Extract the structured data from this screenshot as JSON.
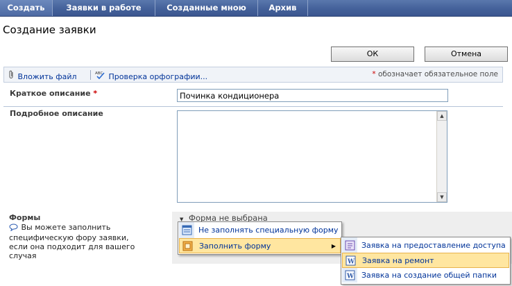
{
  "nav": {
    "tabs": [
      {
        "label": "Создать"
      },
      {
        "label": "Заявки в работе"
      },
      {
        "label": "Созданные мною"
      },
      {
        "label": "Архив"
      }
    ]
  },
  "page": {
    "title": "Создание заявки"
  },
  "actions": {
    "ok_label": "ОК",
    "cancel_label": "Отмена"
  },
  "toolbar": {
    "attach_label": "Вложить файл",
    "spell_label": "Проверка орфографии...",
    "required_star": "*",
    "required_note": "обозначает обязательное поле"
  },
  "fields": {
    "short_desc": {
      "label": "Краткое описание",
      "required_star": "*",
      "value": "Починка кондиционера"
    },
    "long_desc": {
      "label": "Подробное описание",
      "value": ""
    }
  },
  "forms": {
    "label": "Формы",
    "description": "Вы можете заполнить специфическую фору заявки, если она подходит для вашего случая",
    "selected": "Форма не выбрана",
    "menu": [
      {
        "label": "Не заполнять специальную форму",
        "icon": "form-list-icon"
      },
      {
        "label": "Заполнить форму",
        "icon": "form-fill-icon",
        "highlighted": true
      }
    ],
    "submenu": [
      {
        "label": "Заявка на предоставление доступа",
        "icon": "form-doc-icon"
      },
      {
        "label": "Заявка на ремонт",
        "icon": "word-doc-icon",
        "highlighted": true
      },
      {
        "label": "Заявка на создание общей папки",
        "icon": "word-doc-icon"
      }
    ]
  }
}
